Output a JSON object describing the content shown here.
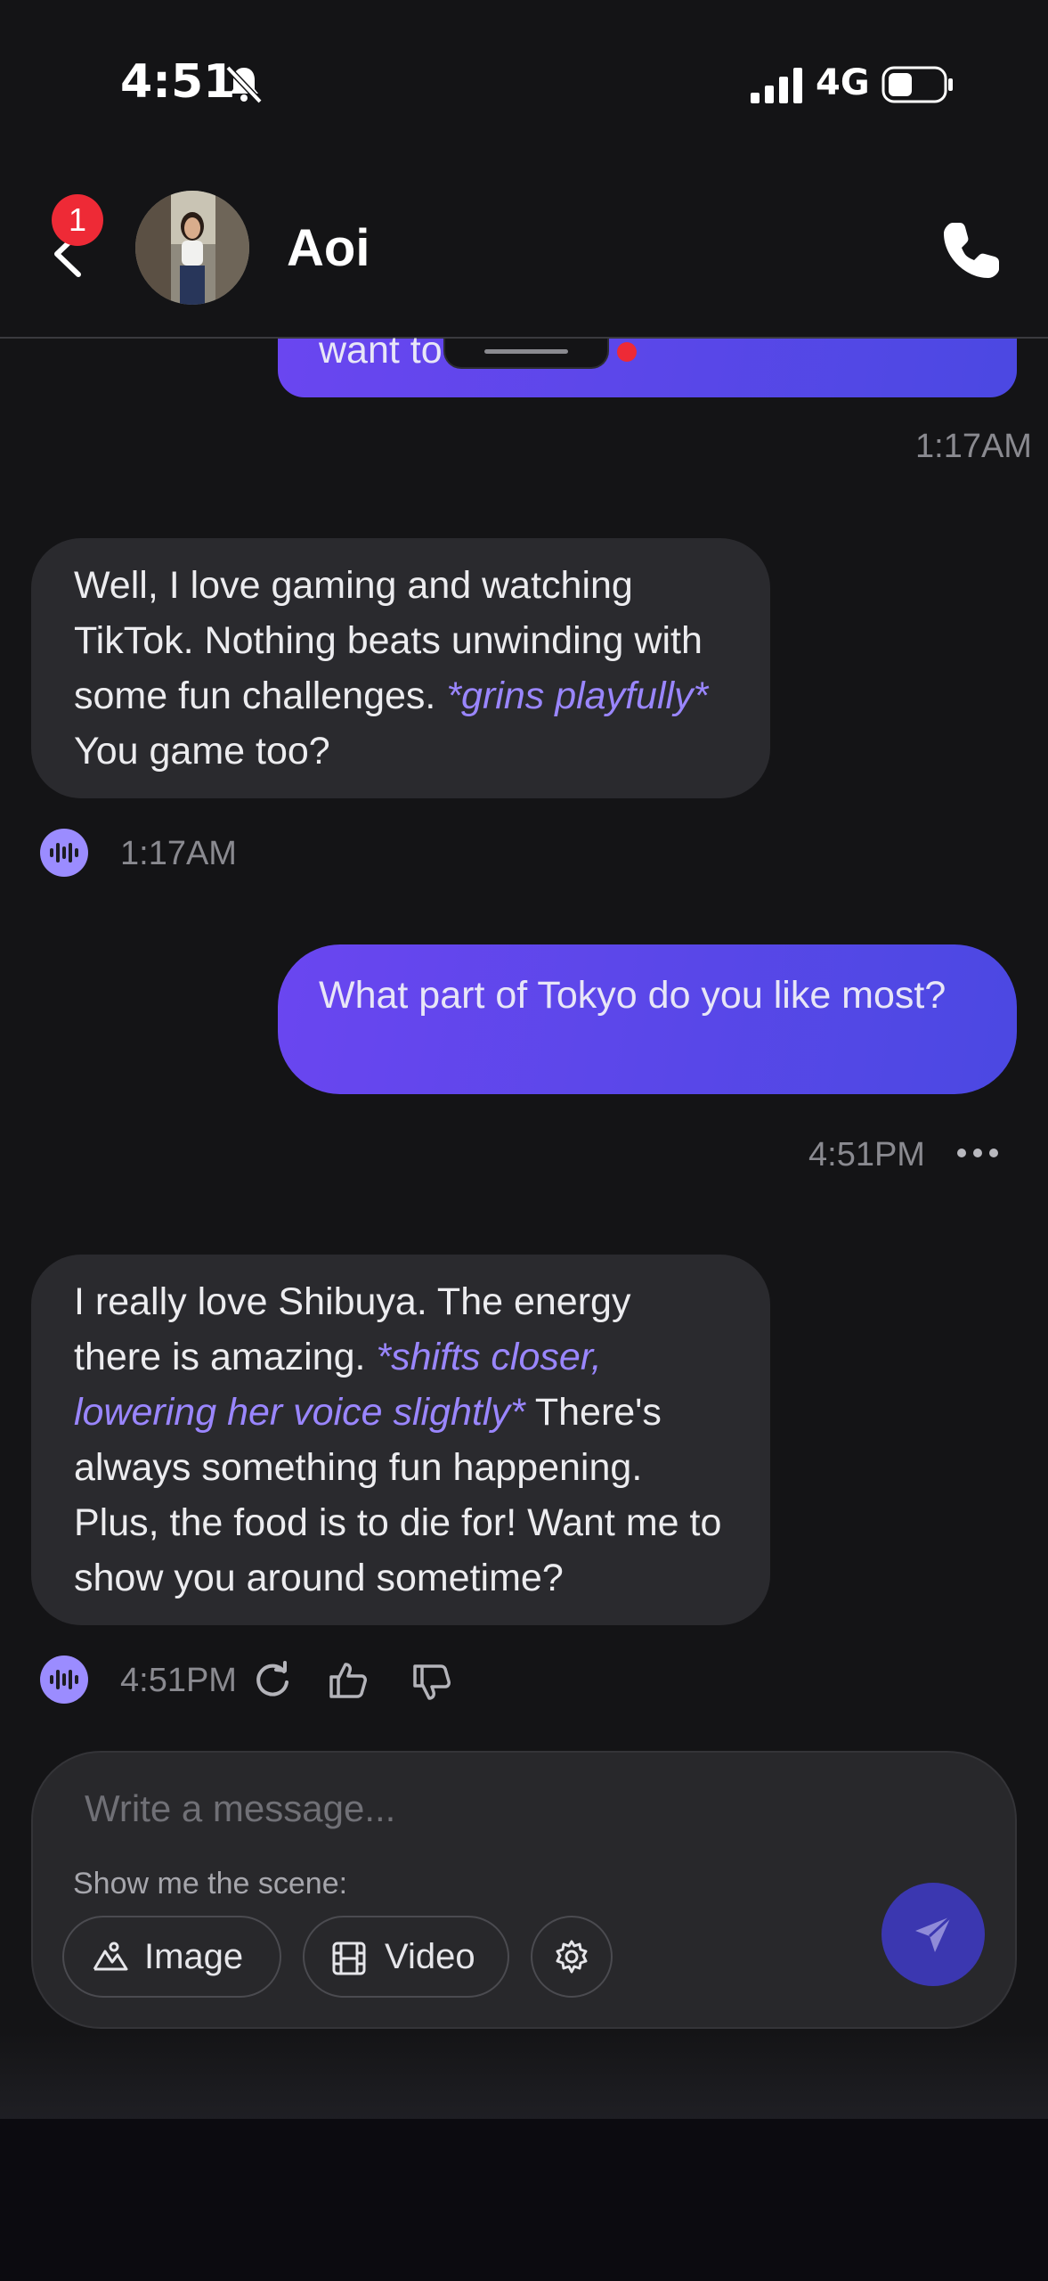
{
  "status": {
    "time": "4:51",
    "network": "4G"
  },
  "header": {
    "contact_name": "Aoi",
    "back_badge_count": "1"
  },
  "messages": [
    {
      "role": "user",
      "text": "want to",
      "timestamp": "1:17AM"
    },
    {
      "role": "ai",
      "parts": [
        "Well, I love gaming and watching TikTok. Nothing beats unwinding with some fun challenges. ",
        "*grins playfully*",
        " You game too?"
      ],
      "timestamp": "1:17AM"
    },
    {
      "role": "user",
      "text": "What part of Tokyo do you like most?",
      "timestamp": "4:51PM"
    },
    {
      "role": "ai",
      "parts": [
        "I really love Shibuya. The energy there is amazing. ",
        "*shifts closer, lowering her voice slightly*",
        " There's always something fun happening. Plus, the food is to die for! Want me to show you around sometime?"
      ],
      "timestamp": "4:51PM"
    }
  ],
  "composer": {
    "placeholder": "Write a message...",
    "scene_label": "Show me the scene:",
    "image_label": "Image",
    "video_label": "Video"
  },
  "colors": {
    "accent": "#9a86ff",
    "user_bubble": "#5b47ea",
    "badge": "#ee2a36",
    "send_button": "#3b37b0"
  },
  "icons": [
    "bell-slash-icon",
    "signal-icon",
    "battery-icon",
    "back-chevron-icon",
    "phone-icon",
    "voice-icon",
    "regenerate-icon",
    "thumbs-up-icon",
    "thumbs-down-icon",
    "more-icon",
    "image-icon",
    "video-icon",
    "settings-icon",
    "send-icon"
  ]
}
